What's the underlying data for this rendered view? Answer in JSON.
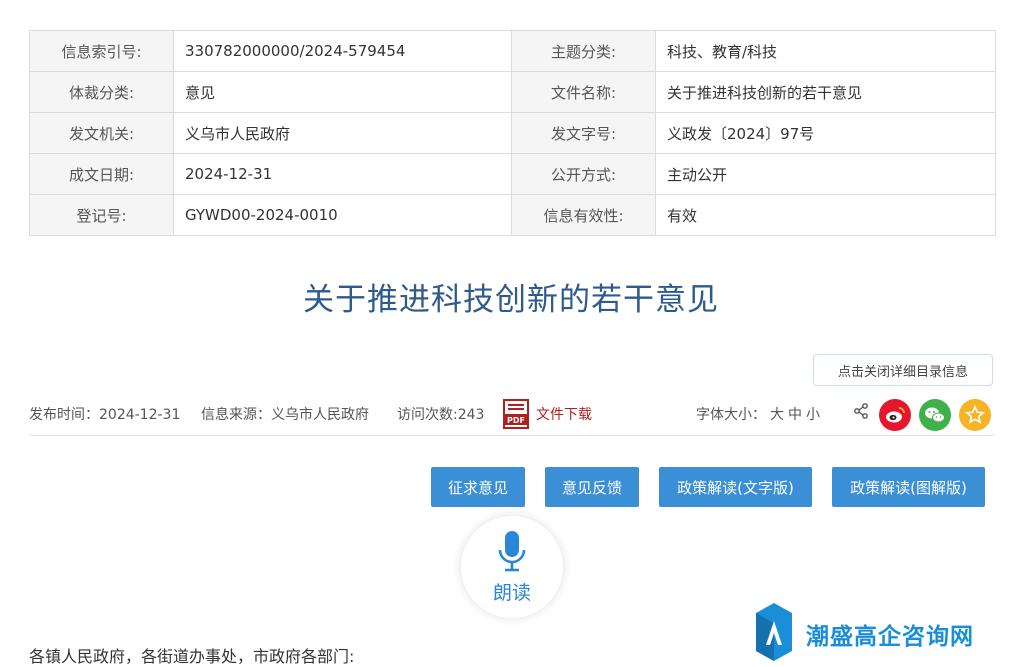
{
  "meta": {
    "rows": [
      {
        "k1": "信息索引号:",
        "v1": "330782000000/2024-579454",
        "k2": "主题分类:",
        "v2": "科技、教育/科技"
      },
      {
        "k1": "体裁分类:",
        "v1": "意见",
        "k2": "文件名称:",
        "v2": "关于推进科技创新的若干意见"
      },
      {
        "k1": "发文机关:",
        "v1": "义乌市人民政府",
        "k2": "发文字号:",
        "v2": "义政发〔2024〕97号"
      },
      {
        "k1": "成文日期:",
        "v1": "2024-12-31",
        "k2": "公开方式:",
        "v2": "主动公开"
      },
      {
        "k1": "登记号:",
        "v1": "GYWD00-2024-0010",
        "k2": "信息有效性:",
        "v2": "有效"
      }
    ]
  },
  "title": "关于推进科技创新的若干意见",
  "toggle_label": "点击关闭详细目录信息",
  "info": {
    "publish": "发布时间：2024-12-31",
    "source": "信息来源：义乌市人民政府",
    "visits": "访问次数:243",
    "pdf_text": "PDF",
    "download": "文件下载",
    "font_label": "字体大小：",
    "font_large": "大",
    "font_medium": "中",
    "font_small": "小"
  },
  "actions": [
    "征求意见",
    "意见反馈",
    "政策解读(文字版)",
    "政策解读(图解版)"
  ],
  "read_aloud": "朗读",
  "salutation": "各镇人民政府，各街道办事处，市政府各部门:",
  "watermark": "潮盛高企咨询网",
  "colors": {
    "title": "#2f5b8c",
    "button": "#3a8fd6",
    "weibo": "#e6162d",
    "wechat": "#3fb14a",
    "favorite": "#f5b325"
  }
}
